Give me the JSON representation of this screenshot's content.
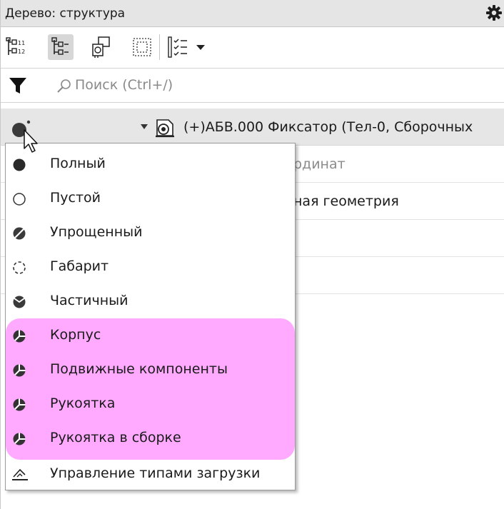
{
  "panel": {
    "title": "Дерево: структура",
    "accent_highlight": "#ffaaff"
  },
  "toolbar": {
    "buttons": [
      {
        "icon": "numbered-tree-icon",
        "active": false
      },
      {
        "icon": "structure-tree-icon",
        "active": true
      },
      {
        "icon": "components-icon",
        "active": false
      },
      {
        "icon": "frame-select-icon",
        "active": false
      },
      {
        "icon": "checklist-icon",
        "active": false
      },
      {
        "icon": "dropdown-triangle-icon",
        "active": false
      }
    ]
  },
  "search": {
    "placeholder": "Поиск (Ctrl+/)"
  },
  "tree": {
    "root_label": "(+)АБВ.000 Фиксатор (Тел-0, Сборочных",
    "partial_rows": [
      "рдинат",
      "ная геометрия"
    ]
  },
  "menu": {
    "items": [
      {
        "label": "Полный",
        "icon": "full-circle-icon"
      },
      {
        "label": "Пустой",
        "icon": "empty-circle-icon"
      },
      {
        "label": "Упрощенный",
        "icon": "simplified-icon"
      },
      {
        "label": "Габарит",
        "icon": "dimension-icon"
      },
      {
        "label": "Частичный",
        "icon": "partial-icon"
      },
      {
        "label": "Корпус",
        "icon": "config-icon"
      },
      {
        "label": "Подвижные компоненты",
        "icon": "config-icon"
      },
      {
        "label": "Рукоятка",
        "icon": "config-icon"
      },
      {
        "label": "Рукоятка в сборке",
        "icon": "config-icon"
      },
      {
        "label": "Управление типами загрузки",
        "icon": "load-types-icon"
      }
    ]
  }
}
